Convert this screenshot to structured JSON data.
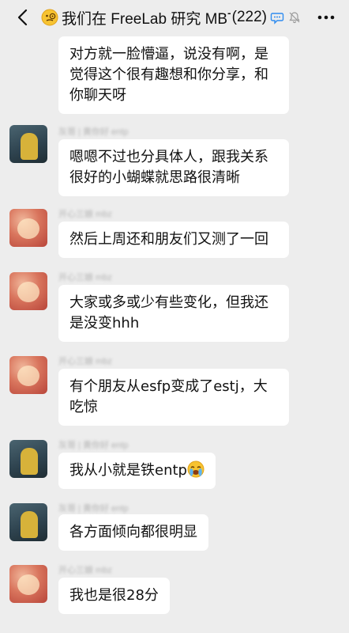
{
  "header": {
    "title": "我们在 FreeLab 研究 MBT",
    "member_count": "(222)",
    "title_emoji": "face-with-monocle",
    "chat_bubble_icon": "chat-bubble-icon",
    "mute_icon": "bell-muted-icon"
  },
  "messages": [
    {
      "avatar": "red-avatar",
      "sender": "开心三娘 mbz",
      "text": "对方就一脸懵逼，说没有啊，是觉得这个很有趣想和你分享，和你聊天呀"
    },
    {
      "avatar": "dark-avatar",
      "sender": "灰哥 | 黄你好 entp",
      "text": "嗯嗯不过也分具体人，跟我关系很好的小蝴蝶就思路很清晰"
    },
    {
      "avatar": "red-avatar",
      "sender": "开心三娘 mbz",
      "text": "然后上周还和朋友们又测了一回"
    },
    {
      "avatar": "red-avatar",
      "sender": "开心三娘 mbz",
      "text": "大家或多或少有些变化，但我还是没变hhh"
    },
    {
      "avatar": "red-avatar",
      "sender": "开心三娘 mbz",
      "text": "有个朋友从esfp变成了estj，大吃惊"
    },
    {
      "avatar": "dark-avatar",
      "sender": "灰哥 | 黄你好 entp",
      "text": "我从小就是铁entp",
      "emoji": "crying-face"
    },
    {
      "avatar": "dark-avatar",
      "sender": "灰哥 | 黄你好 entp",
      "text": "各方面倾向都很明显"
    },
    {
      "avatar": "red-avatar",
      "sender": "开心三娘 mbz",
      "text": "我也是很28分"
    }
  ]
}
